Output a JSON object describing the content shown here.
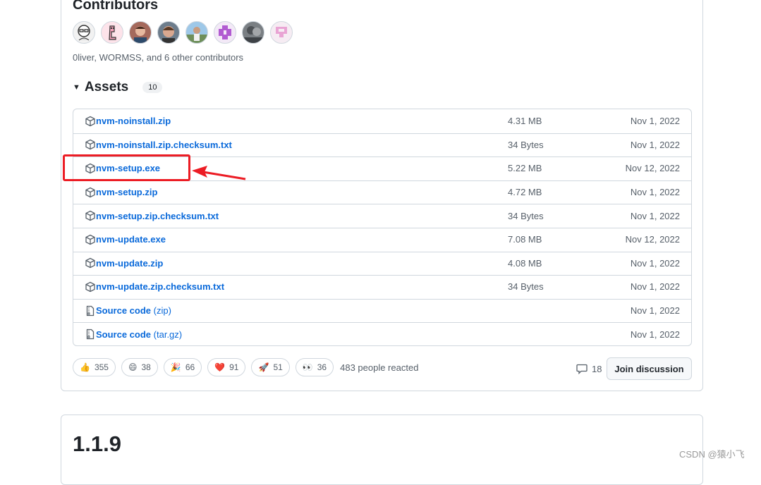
{
  "contributors": {
    "title": "Contributors",
    "summary": "0liver, WORMSS, and 6 other contributors",
    "avatars": [
      "avatar-1",
      "avatar-2",
      "avatar-3",
      "avatar-4",
      "avatar-5",
      "avatar-6",
      "avatar-7",
      "avatar-8"
    ]
  },
  "assets": {
    "title": "Assets",
    "count": "10",
    "rows": [
      {
        "name": "nvm-noinstall.zip",
        "suffix": "",
        "size": "4.31 MB",
        "date": "Nov 1, 2022",
        "icon": "package-icon"
      },
      {
        "name": "nvm-noinstall.zip.checksum.txt",
        "suffix": "",
        "size": "34 Bytes",
        "date": "Nov 1, 2022",
        "icon": "package-icon"
      },
      {
        "name": "nvm-setup.exe",
        "suffix": "",
        "size": "5.22 MB",
        "date": "Nov 12, 2022",
        "icon": "package-icon"
      },
      {
        "name": "nvm-setup.zip",
        "suffix": "",
        "size": "4.72 MB",
        "date": "Nov 1, 2022",
        "icon": "package-icon"
      },
      {
        "name": "nvm-setup.zip.checksum.txt",
        "suffix": "",
        "size": "34 Bytes",
        "date": "Nov 1, 2022",
        "icon": "package-icon"
      },
      {
        "name": "nvm-update.exe",
        "suffix": "",
        "size": "7.08 MB",
        "date": "Nov 12, 2022",
        "icon": "package-icon"
      },
      {
        "name": "nvm-update.zip",
        "suffix": "",
        "size": "4.08 MB",
        "date": "Nov 1, 2022",
        "icon": "package-icon"
      },
      {
        "name": "nvm-update.zip.checksum.txt",
        "suffix": "",
        "size": "34 Bytes",
        "date": "Nov 1, 2022",
        "icon": "package-icon"
      },
      {
        "name": "Source code",
        "suffix": "(zip)",
        "size": "",
        "date": "Nov 1, 2022",
        "icon": "file-zip-icon"
      },
      {
        "name": "Source code",
        "suffix": "(tar.gz)",
        "size": "",
        "date": "Nov 1, 2022",
        "icon": "file-zip-icon"
      }
    ]
  },
  "reactions": {
    "items": [
      {
        "emoji": "👍",
        "count": "355",
        "name": "thumbs-up"
      },
      {
        "emoji": "😄",
        "count": "38",
        "name": "laugh"
      },
      {
        "emoji": "🎉",
        "count": "66",
        "name": "hooray"
      },
      {
        "emoji": "❤️",
        "count": "91",
        "name": "heart"
      },
      {
        "emoji": "🚀",
        "count": "51",
        "name": "rocket"
      },
      {
        "emoji": "👀",
        "count": "36",
        "name": "eyes"
      }
    ],
    "people": "483 people reacted"
  },
  "discussion": {
    "comments": "18",
    "join_label": "Join discussion"
  },
  "next_release": {
    "version": "1.1.9"
  },
  "watermark": "CSDN @猿小飞",
  "colors": {
    "link": "#0969da",
    "highlight": "#ec1c24"
  }
}
